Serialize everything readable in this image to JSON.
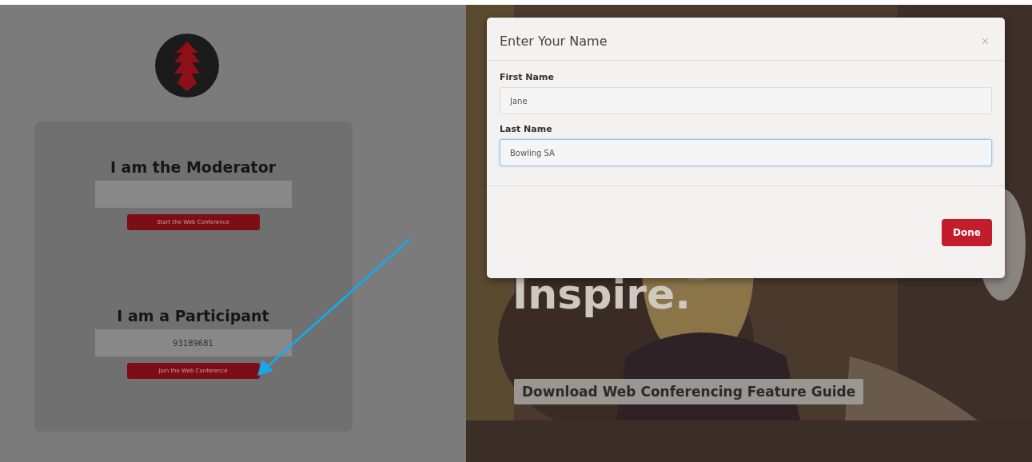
{
  "moderator": {
    "heading": "I am the Moderator",
    "button": "Start the Web Conference"
  },
  "participant": {
    "heading": "I am a Participant",
    "field_value": "93189681",
    "button": "Join the Web Conference"
  },
  "hero": {
    "tagline": "Inspire.",
    "guide_button": "Download Web Conferencing Feature Guide"
  },
  "dialog": {
    "title": "Enter Your Name",
    "close": "×",
    "fields": [
      {
        "label": "First Name",
        "value": "Jane",
        "focused": false
      },
      {
        "label": "Last Name",
        "value": "Bowling SA",
        "focused": true
      }
    ],
    "done_button": "Done"
  }
}
